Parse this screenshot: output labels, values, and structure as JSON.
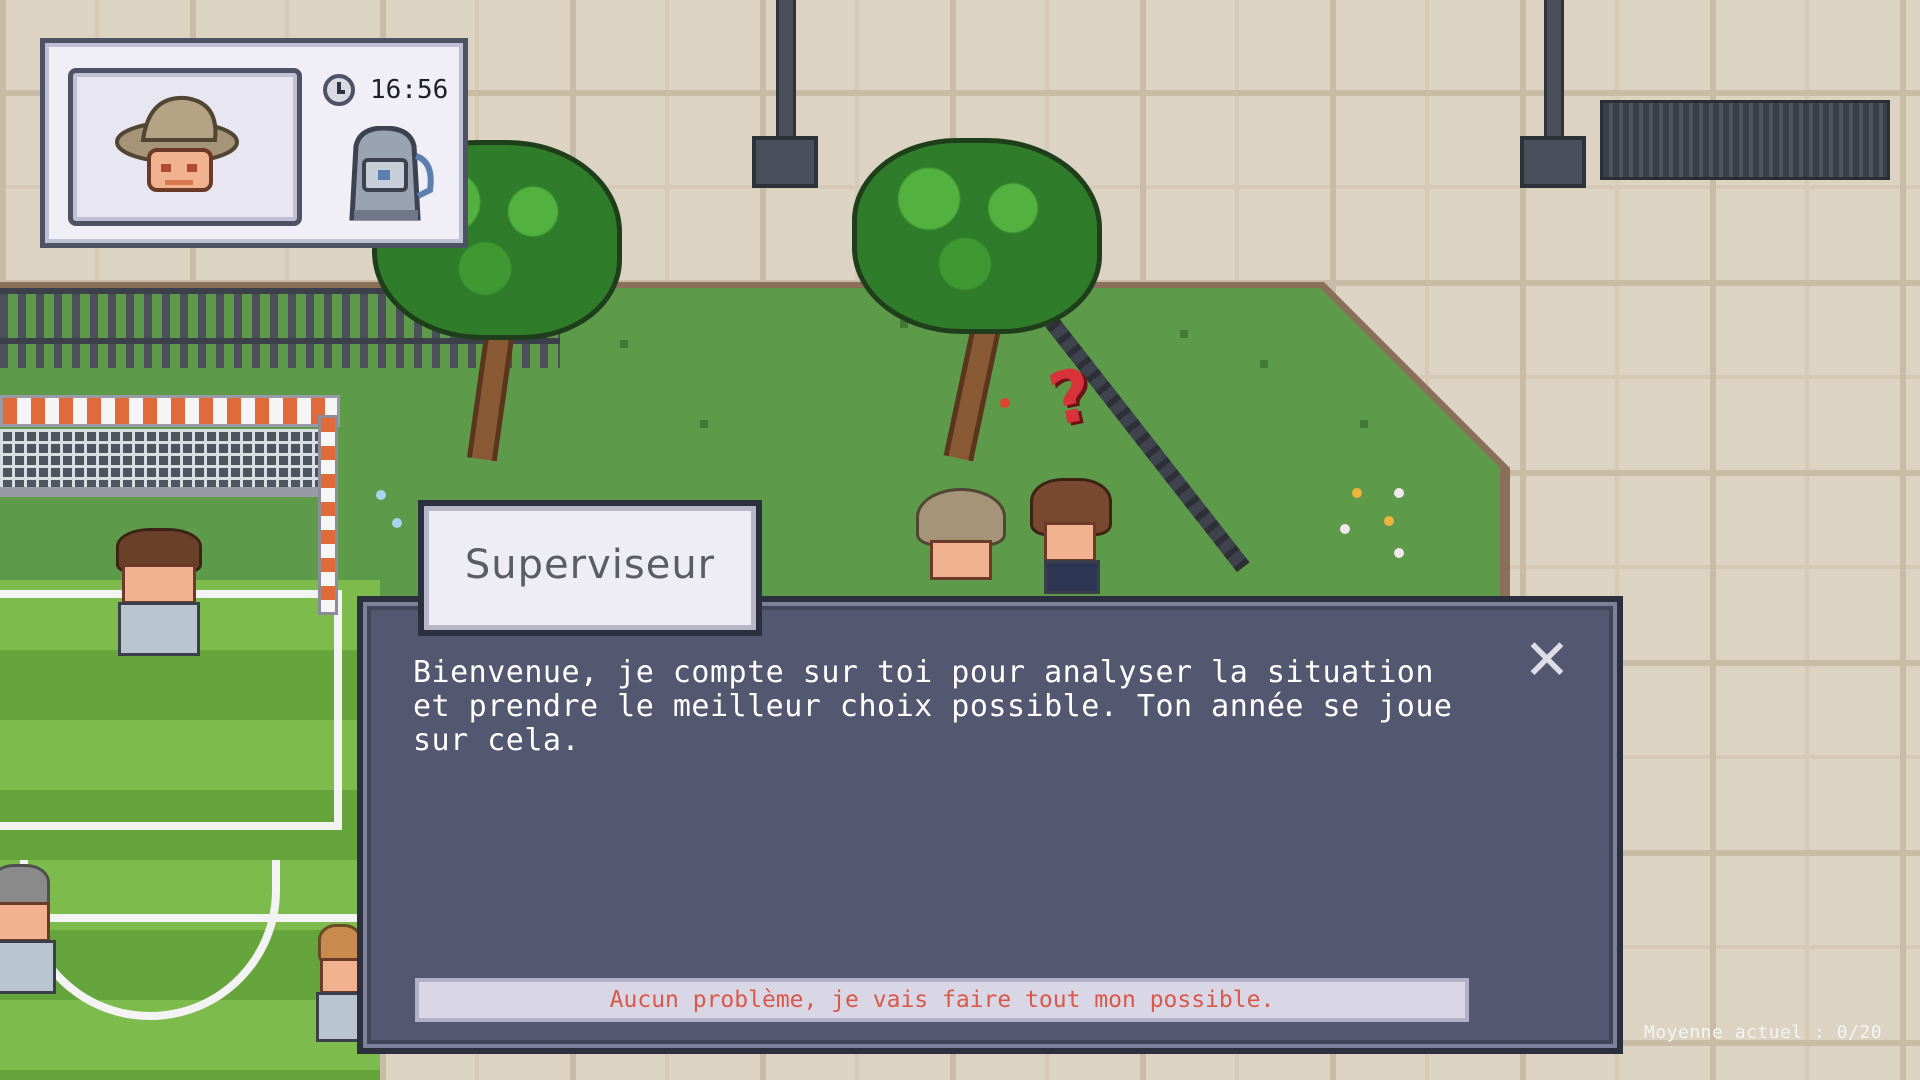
{
  "hud": {
    "time": "16:56",
    "portrait": "supervisor-hat-portrait",
    "inventory_item": "backpack-icon",
    "clock": "clock-icon"
  },
  "dialog": {
    "speaker": "Superviseur",
    "message": "Bienvenue, je compte sur toi pour analyser la situation et prendre le meilleur choix possible. Ton année se joue sur cela.",
    "choice": "Aucun problème, je vais faire tout mon possible.",
    "close_symbol": "✕"
  },
  "status": {
    "average": "Moyenne actuel : 0/20"
  },
  "colors": {
    "dialog_bg": "#535770",
    "choice_text": "#d9584a",
    "quest_marker": "#d8333a"
  }
}
